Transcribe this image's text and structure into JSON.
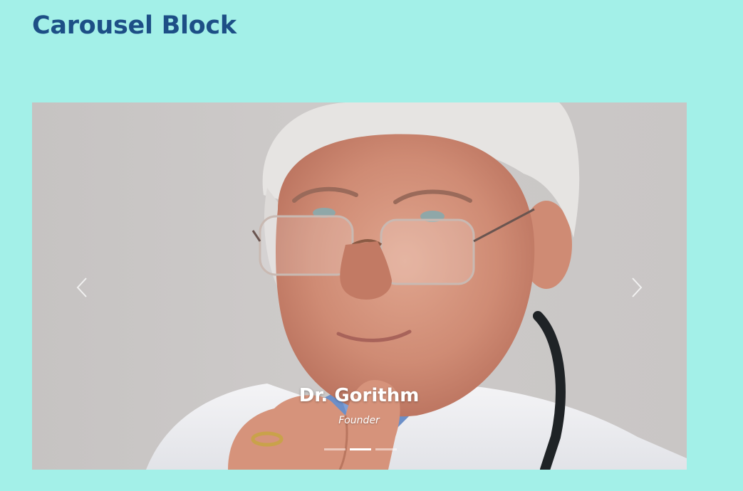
{
  "page": {
    "title": "Carousel Block"
  },
  "carousel": {
    "prev_icon": "chevron-left-icon",
    "next_icon": "chevron-right-icon",
    "slide": {
      "name": "Dr. Gorithm",
      "role": "Founder"
    },
    "slide_count": 3,
    "active_slide": 2
  },
  "colors": {
    "background": "#a3f0e8",
    "heading": "#1d4f86",
    "caption": "#ffffff"
  }
}
